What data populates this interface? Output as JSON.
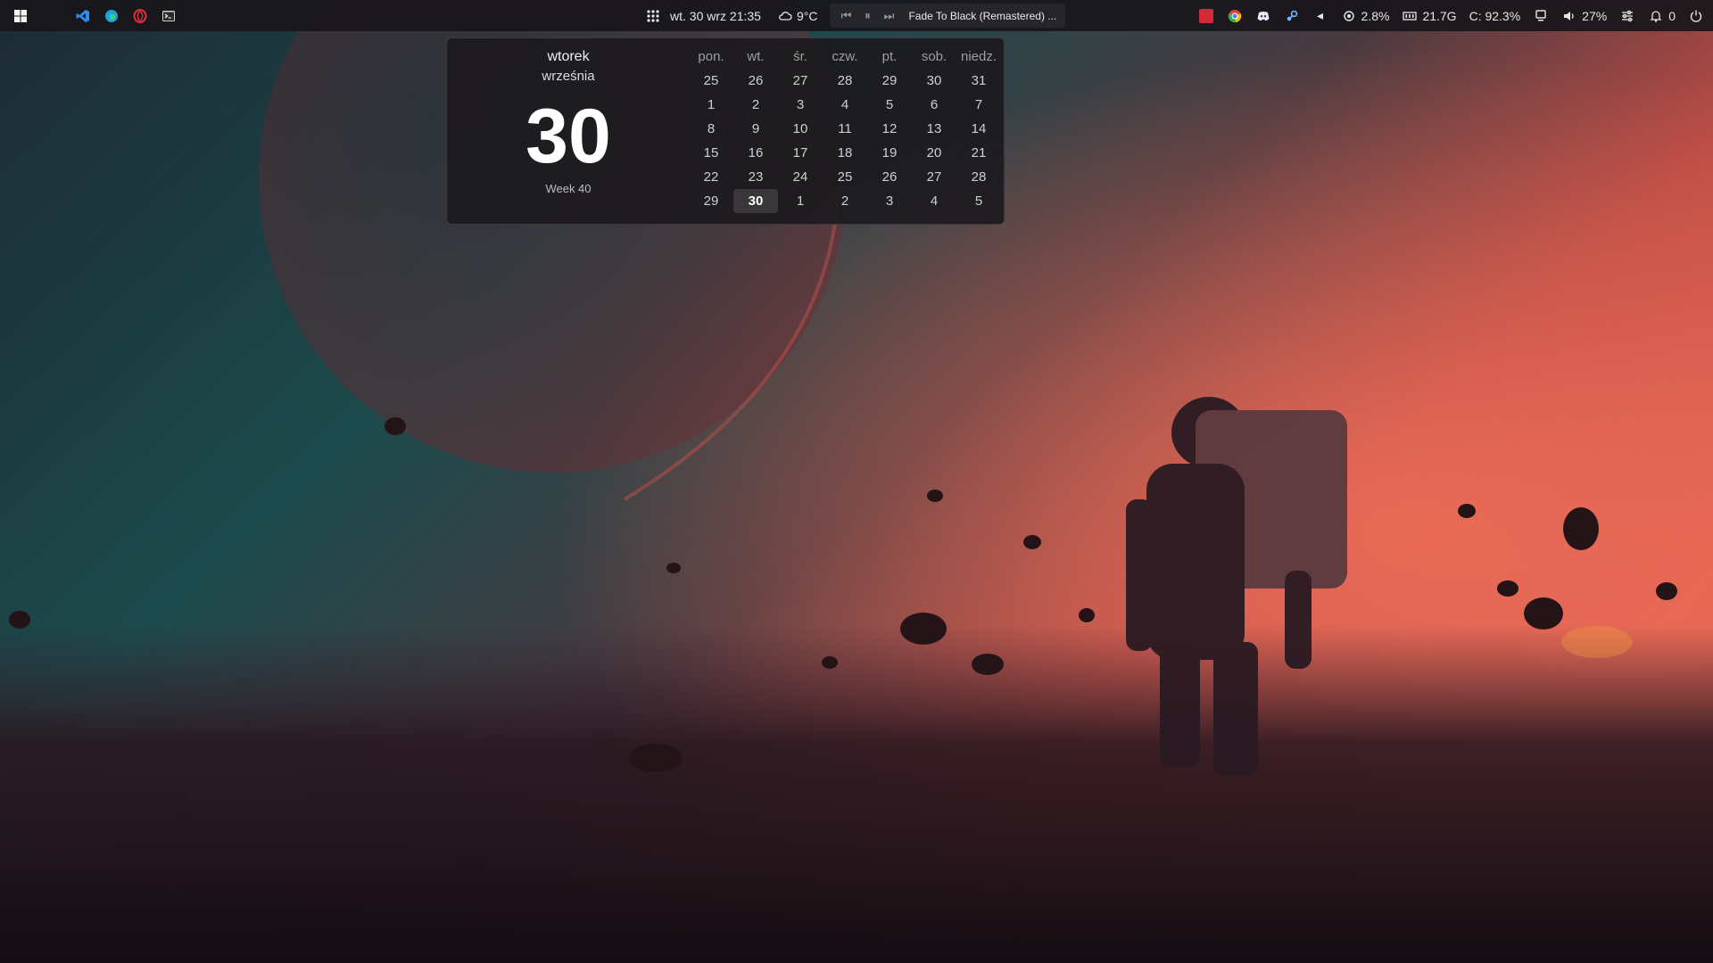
{
  "taskbar": {
    "left_icons": [
      "windows-start-icon",
      "vscode-icon",
      "edge-icon",
      "opera-icon",
      "terminal-icon"
    ],
    "apps_grid_icon": "apps-grid-icon",
    "clock": "wt. 30 wrz 21:35",
    "weather": {
      "icon": "cloud-icon",
      "temp": "9°C"
    },
    "media": {
      "prev": "previous-track-icon",
      "play": "play-pause-icon",
      "next": "next-track-icon",
      "title": "Fade To Black (Remastered) ..."
    },
    "tray": {
      "icons": [
        "red-app-icon",
        "chrome-icon",
        "discord-icon",
        "steam-icon",
        "tray-expand-icon"
      ],
      "cpu": "2.8%",
      "memory": "21.7G",
      "disk": "C: 92.3%",
      "volume": "27%",
      "notifications": "0"
    }
  },
  "calendar": {
    "day_name": "wtorek",
    "month_name": "września",
    "day_number": "30",
    "week": "Week 40",
    "weekdays": [
      "pon.",
      "wt.",
      "śr.",
      "czw.",
      "pt.",
      "sob.",
      "niedz."
    ],
    "weeks": [
      [
        "25",
        "26",
        "27",
        "28",
        "29",
        "30",
        "31"
      ],
      [
        "1",
        "2",
        "3",
        "4",
        "5",
        "6",
        "7"
      ],
      [
        "8",
        "9",
        "10",
        "11",
        "12",
        "13",
        "14"
      ],
      [
        "15",
        "16",
        "17",
        "18",
        "19",
        "20",
        "21"
      ],
      [
        "22",
        "23",
        "24",
        "25",
        "26",
        "27",
        "28"
      ],
      [
        "29",
        "30",
        "1",
        "2",
        "3",
        "4",
        "5"
      ]
    ],
    "today_day": "30"
  },
  "colors": {
    "bar_bg": "#18161a",
    "accent_red": "#d42a3a"
  }
}
